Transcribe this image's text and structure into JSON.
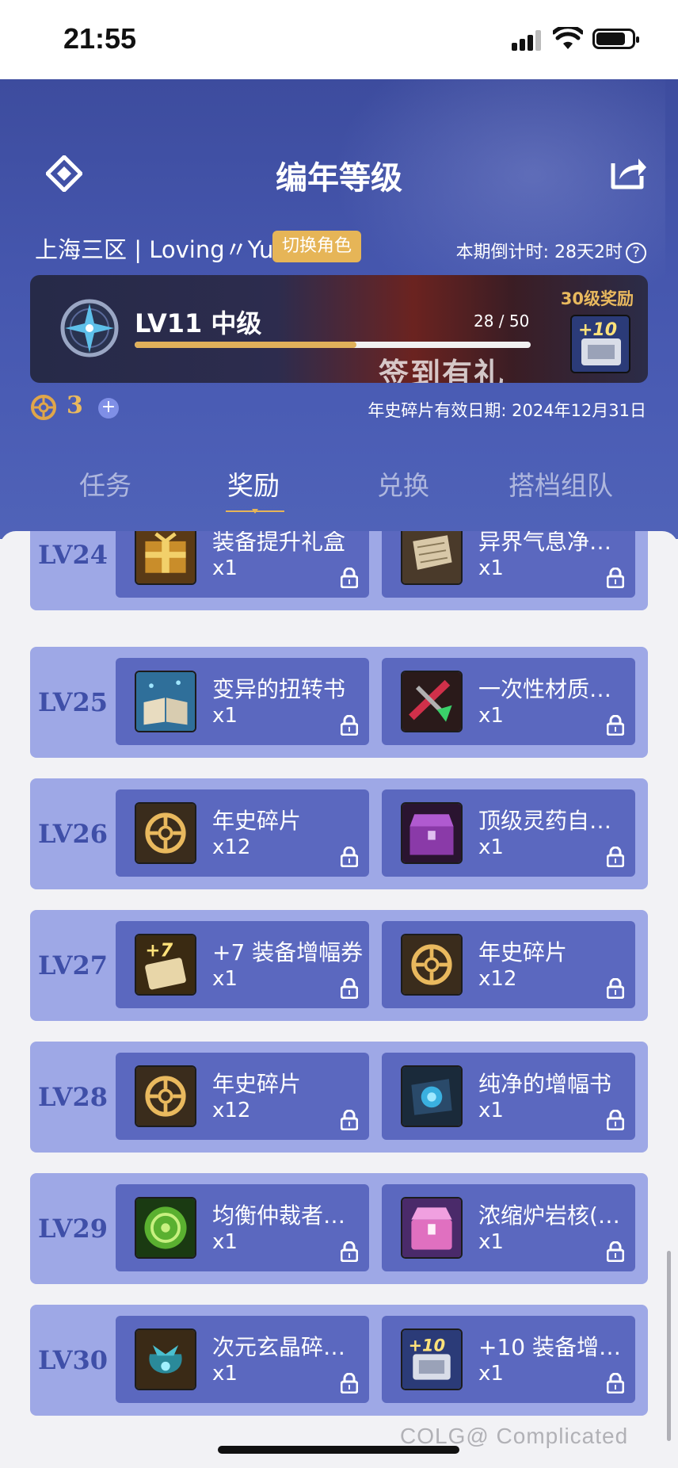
{
  "status_bar": {
    "time": "21:55"
  },
  "header": {
    "title": "编年等级",
    "server": "上海三区 | Loving〃Yu",
    "switch_role": "切换角色",
    "countdown": "本期倒计时: 28天2时",
    "help": "?"
  },
  "level_card": {
    "level": "LV11 中级",
    "progress_text": "28 / 50",
    "progress_fraction": 0.56,
    "reward_label": "30级奖励",
    "banner_text": "签到有礼"
  },
  "fragments": {
    "count": "3",
    "plus": "+",
    "expiry": "年史碎片有效日期: 2024年12月31日"
  },
  "tabs": [
    {
      "label": "任务",
      "active": false
    },
    {
      "label": "奖励",
      "active": true
    },
    {
      "label": "兑换",
      "active": false
    },
    {
      "label": "搭档组队",
      "active": false
    }
  ],
  "rows": [
    {
      "level": "LV24",
      "rewards": [
        {
          "name": "装备提升礼盒",
          "qty": "x1",
          "icon": "gift-box-icon"
        },
        {
          "name": "异界气息净…",
          "qty": "x1",
          "icon": "scroll-icon"
        }
      ]
    },
    {
      "level": "LV25",
      "rewards": [
        {
          "name": "变异的扭转书",
          "qty": "x1",
          "icon": "book-icon"
        },
        {
          "name": "一次性材质…",
          "qty": "x1",
          "icon": "material-icon"
        }
      ]
    },
    {
      "level": "LV26",
      "rewards": [
        {
          "name": "年史碎片",
          "qty": "x12",
          "icon": "fragment-icon"
        },
        {
          "name": "顶级灵药自…",
          "qty": "x1",
          "icon": "chest-icon"
        }
      ]
    },
    {
      "level": "LV27",
      "rewards": [
        {
          "name": "+7 装备增幅券",
          "qty": "x1",
          "icon": "ticket-icon"
        },
        {
          "name": "年史碎片",
          "qty": "x12",
          "icon": "fragment-icon"
        }
      ]
    },
    {
      "level": "LV28",
      "rewards": [
        {
          "name": "年史碎片",
          "qty": "x12",
          "icon": "fragment-icon"
        },
        {
          "name": "纯净的增幅书",
          "qty": "x1",
          "icon": "amplify-book-icon"
        }
      ]
    },
    {
      "level": "LV29",
      "rewards": [
        {
          "name": "均衡仲裁者…",
          "qty": "x1",
          "icon": "token-icon"
        },
        {
          "name": "浓缩炉岩核(…",
          "qty": "x1",
          "icon": "box-icon"
        }
      ]
    },
    {
      "level": "LV30",
      "rewards": [
        {
          "name": "次元玄晶碎…",
          "qty": "x1",
          "icon": "pouch-icon"
        },
        {
          "name": "+10 装备增…",
          "qty": "x1",
          "icon": "ticket10-icon"
        }
      ]
    }
  ],
  "watermark": "COLG@ Complicated",
  "colors": {
    "header": "#4556ad",
    "gold": "#e6b557",
    "row": "#9ea8e6",
    "reward": "#5b68bf"
  }
}
